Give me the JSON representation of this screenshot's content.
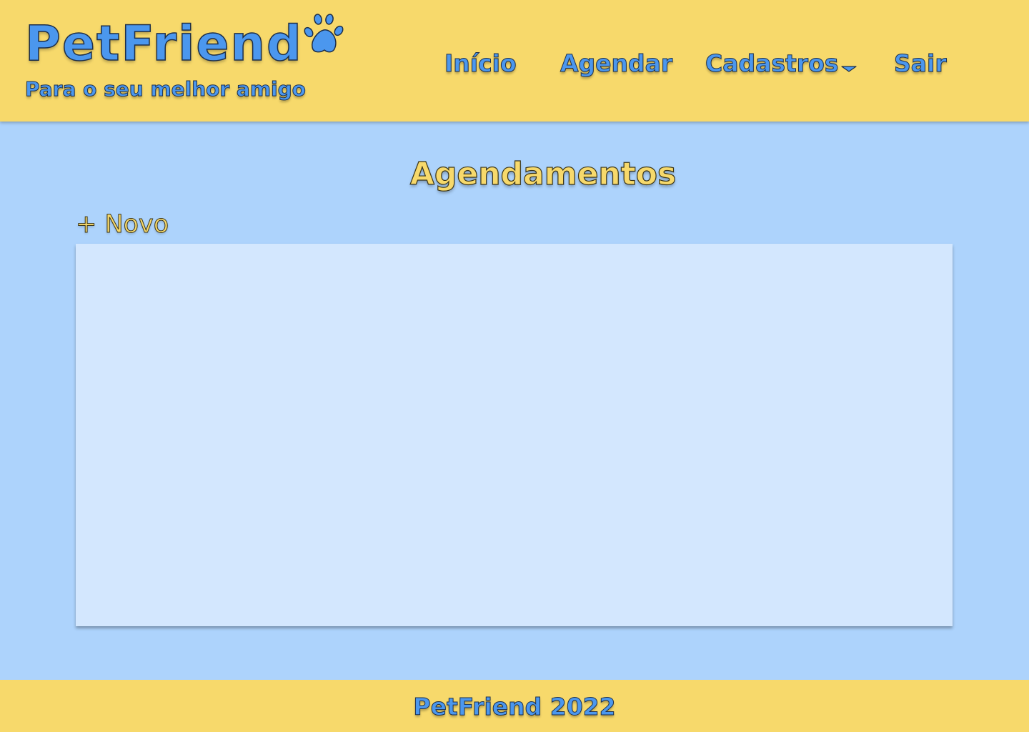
{
  "brand": {
    "name": "PetFriend",
    "tagline": "Para o seu melhor amigo",
    "logo_icon": "paw-icon"
  },
  "nav": {
    "items": [
      {
        "label": "Início"
      },
      {
        "label": "Agendar"
      },
      {
        "label": "Cadastros",
        "icon": "chevron-down-icon"
      },
      {
        "label": "Sair"
      }
    ]
  },
  "main": {
    "title": "Agendamentos",
    "new_button_label": "+ Novo"
  },
  "footer": {
    "text": "PetFriend 2022"
  },
  "colors": {
    "header_bg": "#f7d96b",
    "page_bg": "#add3fc",
    "panel_bg": "#d3e7fe",
    "brand_blue": "#4b97ee",
    "accent_yellow": "#f7d96b"
  }
}
